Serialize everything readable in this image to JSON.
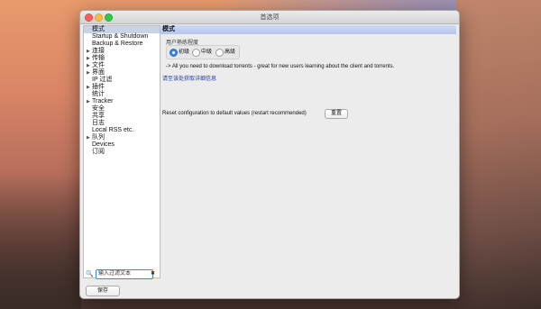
{
  "window": {
    "title": "首选项"
  },
  "sidebar": {
    "items": [
      {
        "label": "模式",
        "arrow": "",
        "selected": true
      },
      {
        "label": "Startup & Shutdown",
        "arrow": ""
      },
      {
        "label": "Backup & Restore",
        "arrow": ""
      },
      {
        "label": "连接",
        "arrow": "▶"
      },
      {
        "label": "传输",
        "arrow": "▶"
      },
      {
        "label": "文件",
        "arrow": "▶"
      },
      {
        "label": "界面",
        "arrow": "▶"
      },
      {
        "label": "IP 过滤",
        "arrow": ""
      },
      {
        "label": "插件",
        "arrow": "▶"
      },
      {
        "label": "统计",
        "arrow": ""
      },
      {
        "label": "Tracker",
        "arrow": "▶"
      },
      {
        "label": "安全",
        "arrow": ""
      },
      {
        "label": "共享",
        "arrow": ""
      },
      {
        "label": "日志",
        "arrow": ""
      },
      {
        "label": "Local RSS etc.",
        "arrow": ""
      },
      {
        "label": "队列",
        "arrow": "▶"
      },
      {
        "label": "Devices",
        "arrow": ""
      },
      {
        "label": "订阅",
        "arrow": ""
      }
    ],
    "filter": {
      "placeholder": "输入过滤文本",
      "clear_icon": "✖",
      "search_icon": "🔍"
    },
    "save_label": "保存"
  },
  "panel": {
    "header": "模式",
    "group_label": "用户熟练程度",
    "radios": [
      {
        "label": "初级",
        "checked": true
      },
      {
        "label": "中级",
        "checked": false
      },
      {
        "label": "高级",
        "checked": false
      }
    ],
    "description": "-> All you need to download torrents - great for new users learning about the client and torrents.",
    "more_info_link": "请至该处获取详细信息",
    "reset_label": "Reset configuration to default values (restart recommended)",
    "reset_button": "重置"
  }
}
